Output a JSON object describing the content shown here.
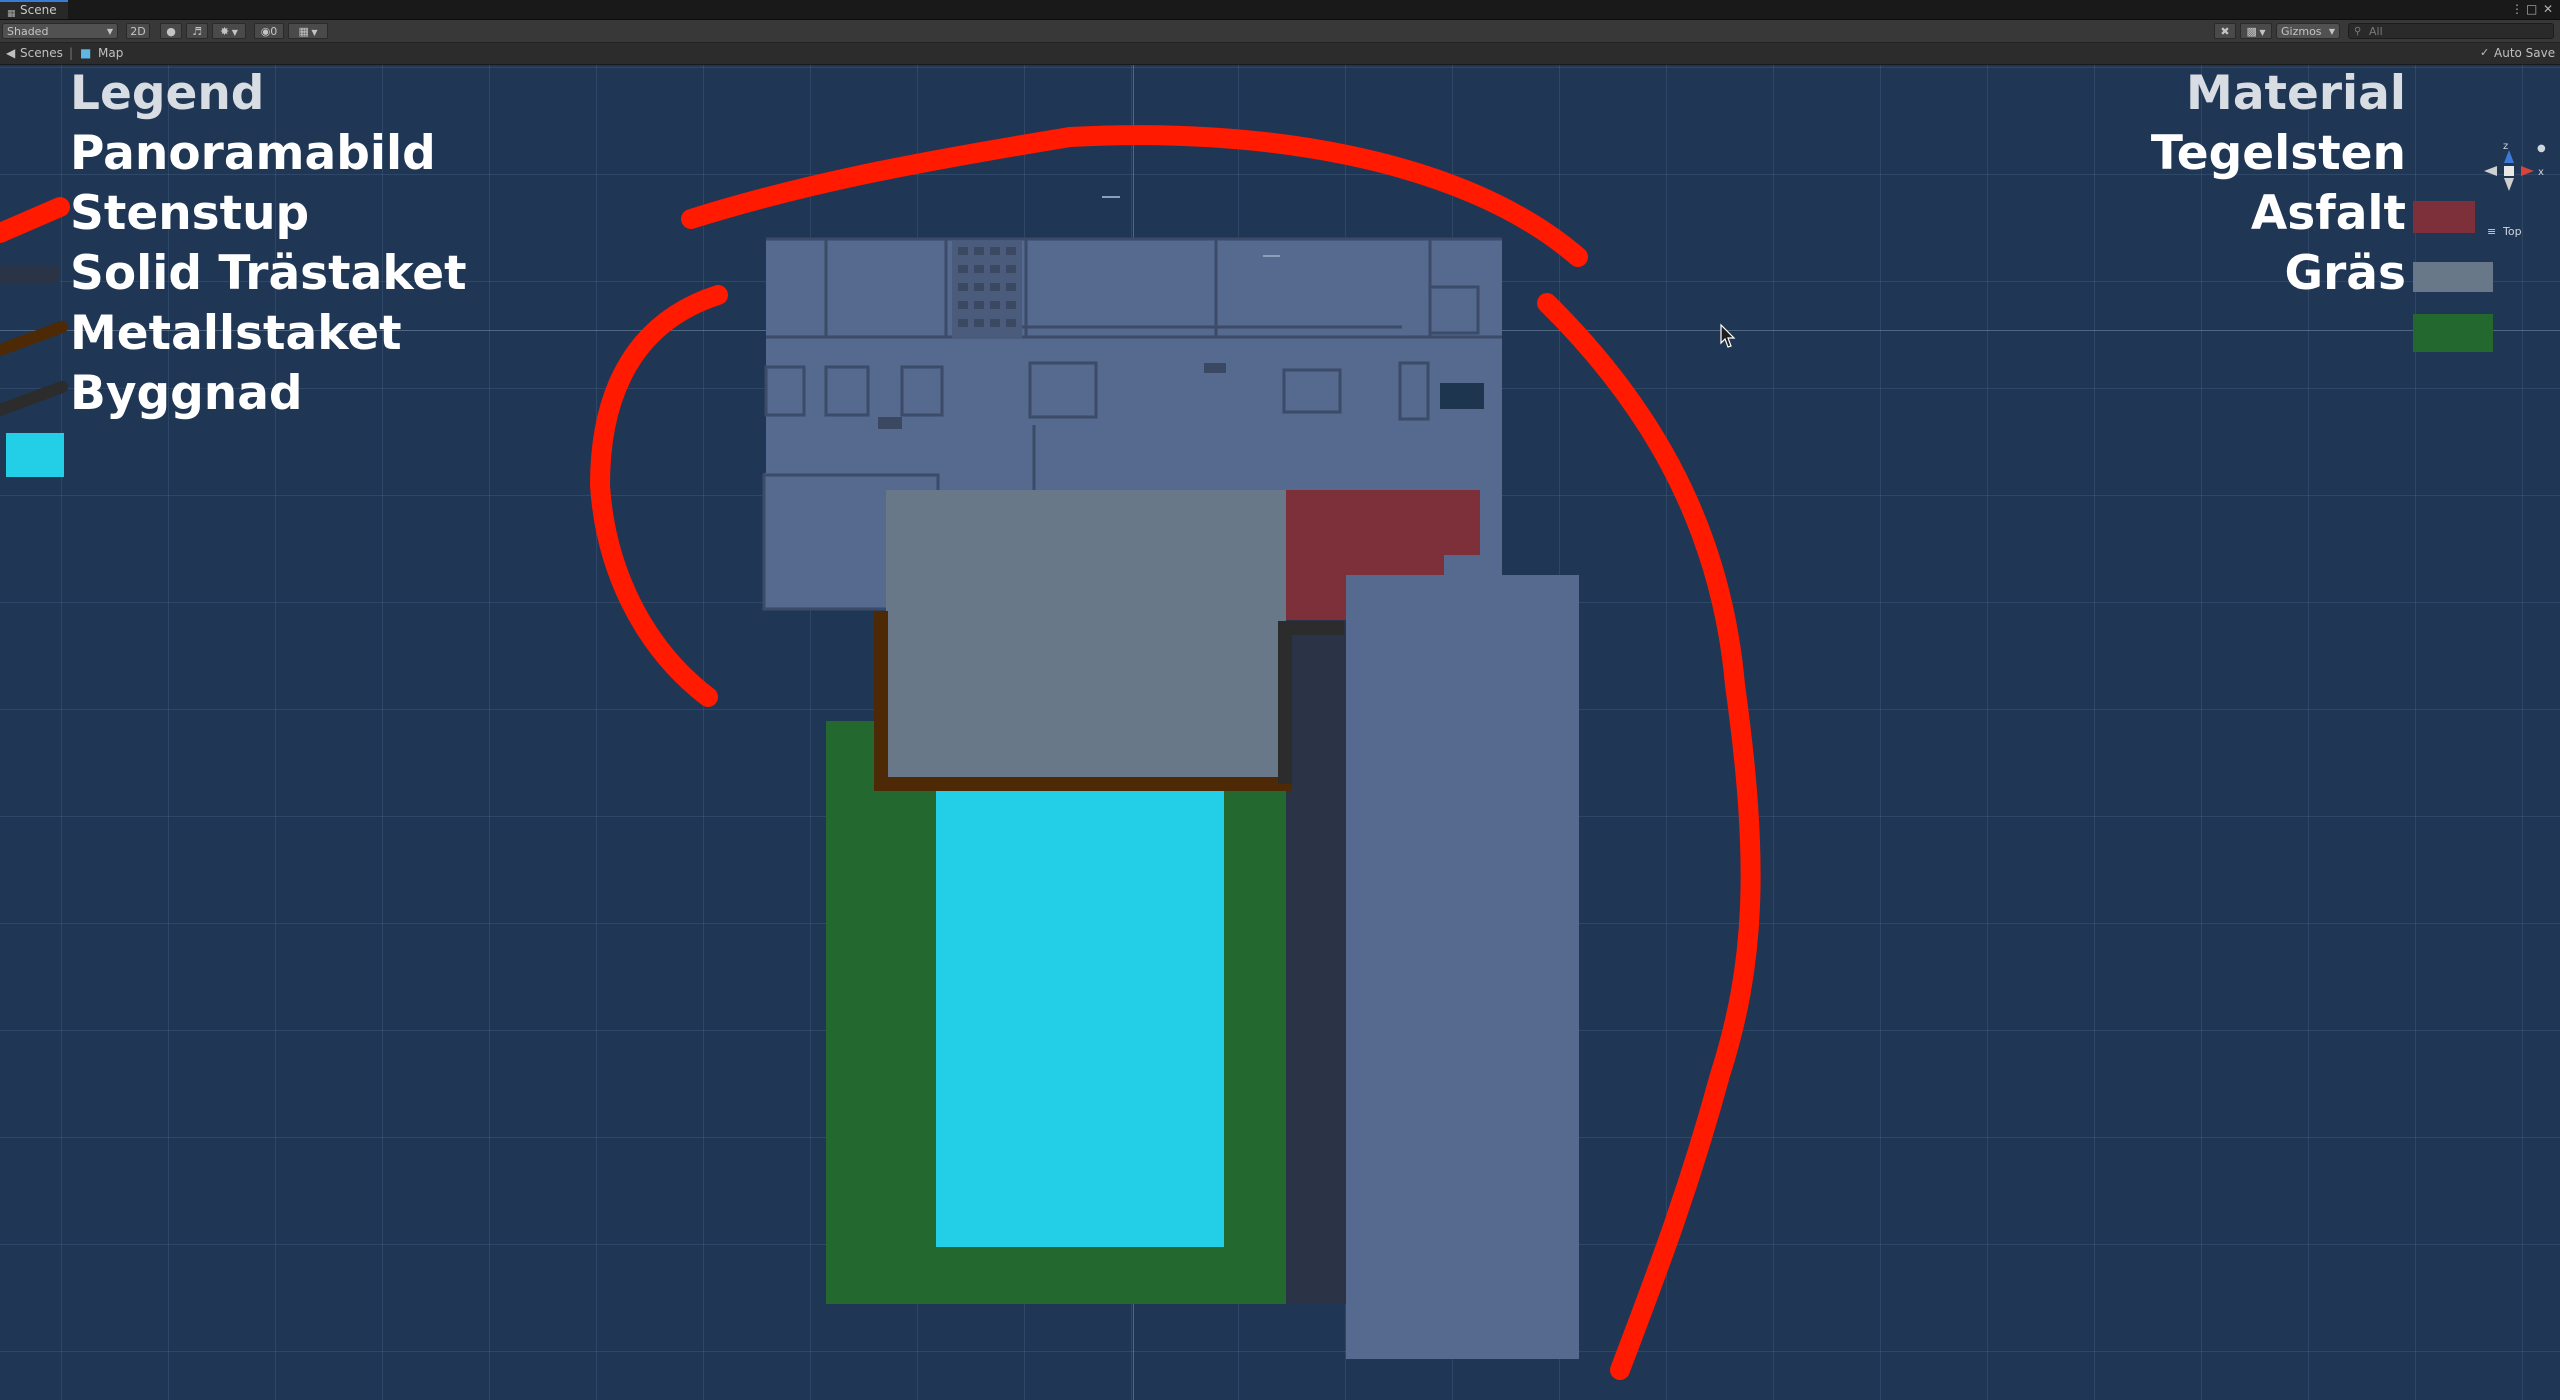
{
  "window": {
    "tab_label": "Scene",
    "tab_icon": "grid-icon",
    "controls": [
      "kebab-menu-icon",
      "maximize-icon",
      "close-icon"
    ]
  },
  "toolbar": {
    "draw_mode": "Shaded",
    "mode_2d": "2D",
    "hidden_count": "0",
    "gizmos_label": "Gizmos",
    "search_placeholder": "All"
  },
  "breadcrumb": {
    "scenes_label": "Scenes",
    "separator": "|",
    "current_label": "Map",
    "auto_save_label": "Auto Save",
    "auto_save_checked": true
  },
  "scene_gizmo": {
    "z_label": "z",
    "x_label": "x",
    "view_label": "Top"
  },
  "legend": {
    "title": "Legend",
    "items": [
      {
        "label": "Panoramabild",
        "symbol": "red-stroke",
        "color": "#ff1a00"
      },
      {
        "label": "Stenstup",
        "symbol": "dark-stroke",
        "color": "#2a3446"
      },
      {
        "label": "Solid Trästaket",
        "symbol": "brown-stroke",
        "color": "#4d2a05"
      },
      {
        "label": "Metallstaket",
        "symbol": "charcoal-stroke",
        "color": "#2c2c2c"
      },
      {
        "label": "Byggnad",
        "symbol": "cyan-box",
        "color": "#22cfe6"
      }
    ]
  },
  "material": {
    "title": "Material",
    "items": [
      {
        "label": "Tegelsten",
        "color": "#7d2f3a"
      },
      {
        "label": "Asfalt",
        "color": "#687888"
      },
      {
        "label": "Gräs",
        "color": "#22682f"
      }
    ]
  },
  "colors": {
    "background": "#1f3654",
    "building_floor": "#566a90",
    "asphalt": "#687888",
    "brick": "#7d2f3a",
    "grass": "#22682f",
    "building": "#22cfe6",
    "panorama_stroke": "#ff1a00",
    "wood_fence": "#4d2a05",
    "metal_fence": "#2c2c2c",
    "stone_path": "#2a3446"
  }
}
